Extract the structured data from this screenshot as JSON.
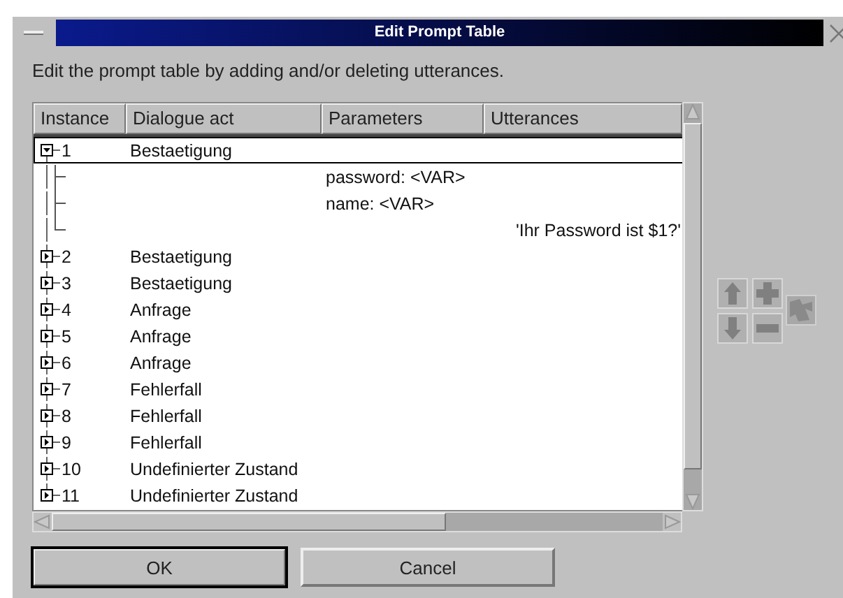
{
  "window": {
    "title": "Edit Prompt Table"
  },
  "instruction": "Edit the prompt table by adding and/or deleting utterances.",
  "table": {
    "columns": [
      "Instance",
      "Dialogue act",
      "Parameters",
      "Utterances"
    ],
    "rows": [
      {
        "instance": "1",
        "dialogue_act": "Bestaetigung",
        "expanded": true,
        "selected": true,
        "children": [
          {
            "kind": "parameter",
            "text": "password: <VAR>"
          },
          {
            "kind": "parameter",
            "text": "name: <VAR>"
          },
          {
            "kind": "utterance",
            "text": "'Ihr Password ist $1?'"
          }
        ]
      },
      {
        "instance": "2",
        "dialogue_act": "Bestaetigung",
        "expanded": false,
        "selected": false
      },
      {
        "instance": "3",
        "dialogue_act": "Bestaetigung",
        "expanded": false,
        "selected": false
      },
      {
        "instance": "4",
        "dialogue_act": "Anfrage",
        "expanded": false,
        "selected": false
      },
      {
        "instance": "5",
        "dialogue_act": "Anfrage",
        "expanded": false,
        "selected": false
      },
      {
        "instance": "6",
        "dialogue_act": "Anfrage",
        "expanded": false,
        "selected": false
      },
      {
        "instance": "7",
        "dialogue_act": "Fehlerfall",
        "expanded": false,
        "selected": false
      },
      {
        "instance": "8",
        "dialogue_act": "Fehlerfall",
        "expanded": false,
        "selected": false
      },
      {
        "instance": "9",
        "dialogue_act": "Fehlerfall",
        "expanded": false,
        "selected": false
      },
      {
        "instance": "10",
        "dialogue_act": "Undefinierter Zustand",
        "expanded": false,
        "selected": false
      },
      {
        "instance": "11",
        "dialogue_act": "Undefinierter Zustand",
        "expanded": false,
        "selected": false
      }
    ]
  },
  "buttons": [
    {
      "label": "OK",
      "default": true
    },
    {
      "label": "Cancel",
      "default": false
    }
  ]
}
